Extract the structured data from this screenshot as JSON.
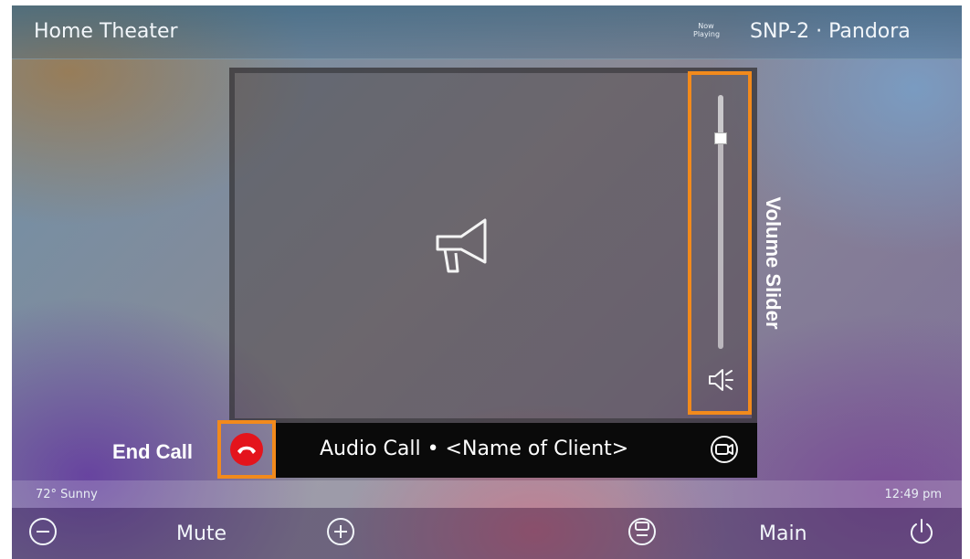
{
  "header": {
    "room_title": "Home Theater",
    "now_playing_line1": "Now",
    "now_playing_line2": "Playing",
    "source": "SNP-2 · Pandora"
  },
  "call": {
    "info": "Audio Call • <Name of Client>",
    "volume_level": 0.83
  },
  "callouts": {
    "volume_slider": "Volume Slider",
    "end_call": "End Call"
  },
  "status": {
    "weather": "72°  Sunny",
    "time": "12:49 pm"
  },
  "bottom": {
    "mute_label": "Mute",
    "main_label": "Main"
  },
  "colors": {
    "highlight": "#f28a1c",
    "end_call_red": "#e4141c"
  },
  "icons": [
    "megaphone-icon",
    "speaker-mute-icon",
    "video-toggle-icon",
    "hang-up-icon",
    "minus-icon",
    "plus-icon",
    "remote-icon",
    "power-icon"
  ]
}
